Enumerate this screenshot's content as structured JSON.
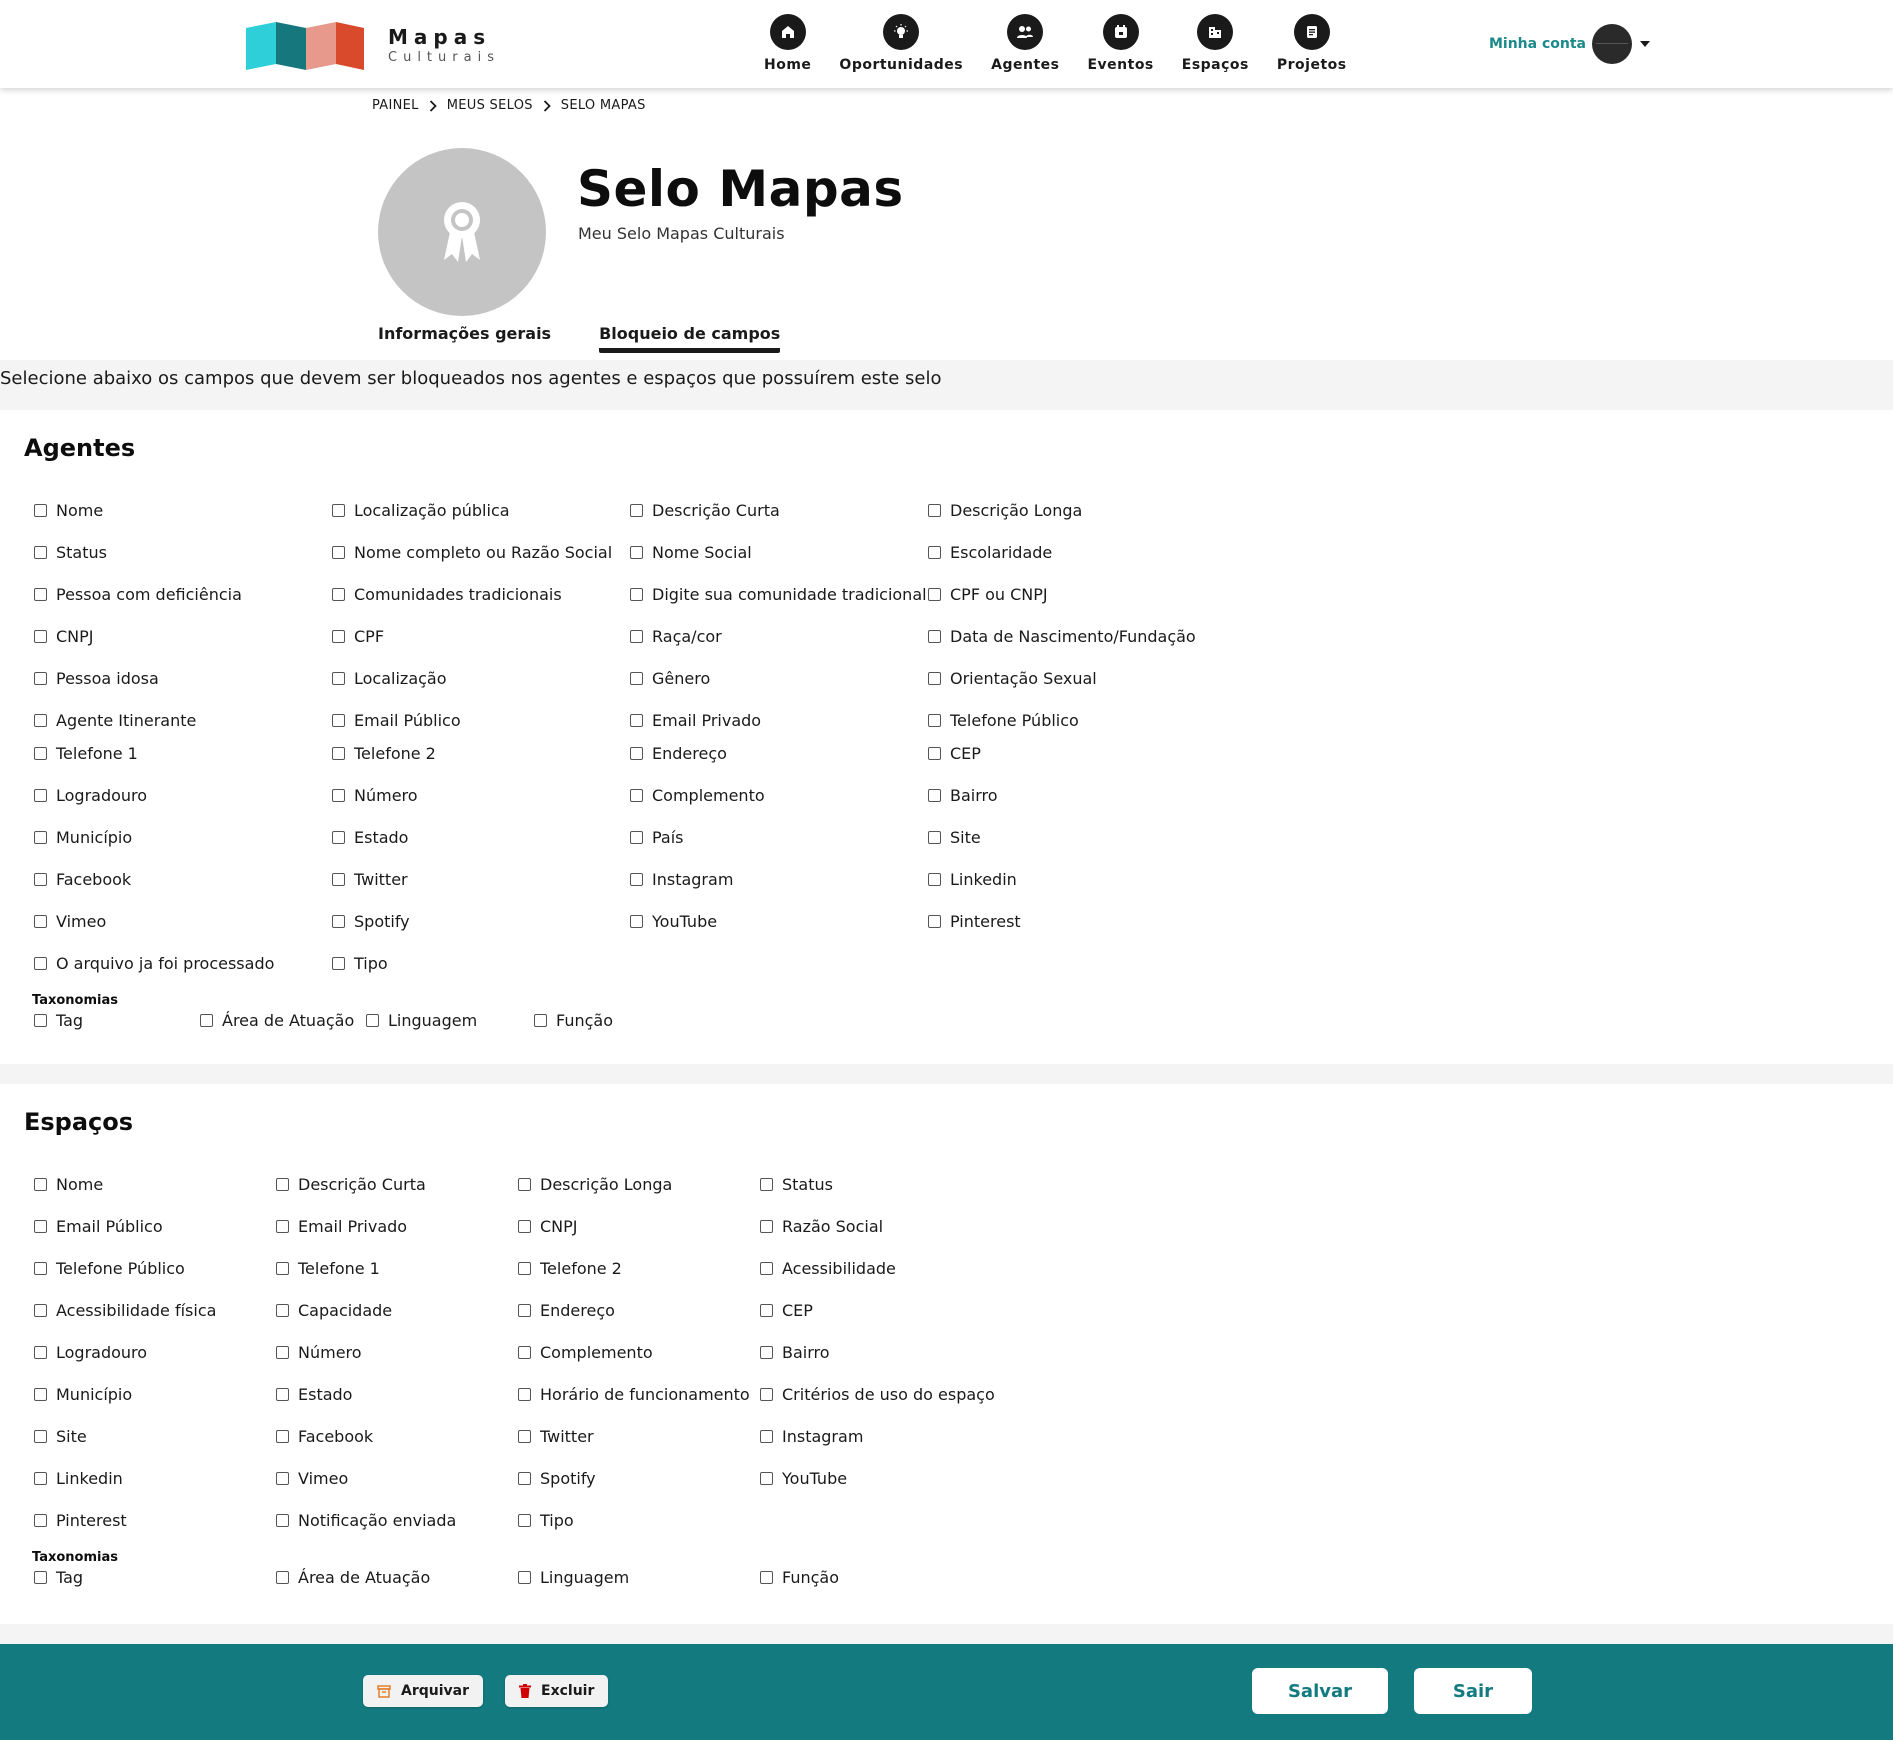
{
  "brand": {
    "line1": "Mapas",
    "line2": "Culturais"
  },
  "nav": [
    {
      "label": "Home",
      "icon": "home-icon"
    },
    {
      "label": "Oportunidades",
      "icon": "lightbulb-icon"
    },
    {
      "label": "Agentes",
      "icon": "people-icon"
    },
    {
      "label": "Eventos",
      "icon": "calendar-icon"
    },
    {
      "label": "Espaços",
      "icon": "building-icon"
    },
    {
      "label": "Projetos",
      "icon": "document-icon"
    }
  ],
  "account": {
    "label": "Minha conta"
  },
  "breadcrumb": [
    "PAINEL",
    "MEUS SELOS",
    "SELO MAPAS"
  ],
  "seal": {
    "title": "Selo Mapas",
    "subtitle": "Meu Selo Mapas Culturais"
  },
  "tabs": [
    "Informações gerais",
    "Bloqueio de campos"
  ],
  "instruction": "Selecione abaixo os campos que devem ser bloqueados nos agentes e espaços que possuírem este selo",
  "agentes": {
    "title": "Agentes",
    "fields": [
      "Nome",
      "Localização pública",
      "Descrição Curta",
      "Descrição Longa",
      "Status",
      "Nome completo ou Razão Social",
      "Nome Social",
      "Escolaridade",
      "Pessoa com deficiência",
      "Comunidades tradicionais",
      "Digite sua comunidade tradicional",
      "CPF ou CNPJ",
      "CNPJ",
      "CPF",
      "Raça/cor",
      "Data de Nascimento/Fundação",
      "Pessoa idosa",
      "Localização",
      "Gênero",
      "Orientação Sexual",
      "Agente Itinerante",
      "Email Público",
      "Email Privado",
      "Telefone Público",
      "Telefone 1",
      "Telefone 2",
      "Endereço",
      "CEP",
      "Logradouro",
      "Número",
      "Complemento",
      "Bairro",
      "Município",
      "Estado",
      "País",
      "Site",
      "Facebook",
      "Twitter",
      "Instagram",
      "Linkedin",
      "Vimeo",
      "Spotify",
      "YouTube",
      "Pinterest",
      "O arquivo ja foi processado",
      "Tipo"
    ],
    "taxonomy_label": "Taxonomias",
    "taxonomies": [
      "Tag",
      "Área de Atuação",
      "Linguagem",
      "Função"
    ]
  },
  "espacos": {
    "title": "Espaços",
    "fields": [
      "Nome",
      "Descrição Curta",
      "Descrição Longa",
      "Status",
      "Email Público",
      "Email Privado",
      "CNPJ",
      "Razão Social",
      "Telefone Público",
      "Telefone 1",
      "Telefone 2",
      "Acessibilidade",
      "Acessibilidade física",
      "Capacidade",
      "Endereço",
      "CEP",
      "Logradouro",
      "Número",
      "Complemento",
      "Bairro",
      "Município",
      "Estado",
      "Horário de funcionamento",
      "Critérios de uso do espaço",
      "Site",
      "Facebook",
      "Twitter",
      "Instagram",
      "Linkedin",
      "Vimeo",
      "Spotify",
      "YouTube",
      "Pinterest",
      "Notificação enviada",
      "Tipo"
    ],
    "taxonomy_label": "Taxonomias",
    "taxonomies": [
      "Tag",
      "Área de Atuação",
      "Linguagem",
      "Função"
    ]
  },
  "footer": {
    "archive_label": "Arquivar",
    "delete_label": "Excluir",
    "save_label": "Salvar",
    "exit_label": "Sair"
  },
  "colors": {
    "accent": "#137a80",
    "link": "#1c8a8a",
    "danger": "#d00000",
    "archive": "#e07a1f"
  }
}
